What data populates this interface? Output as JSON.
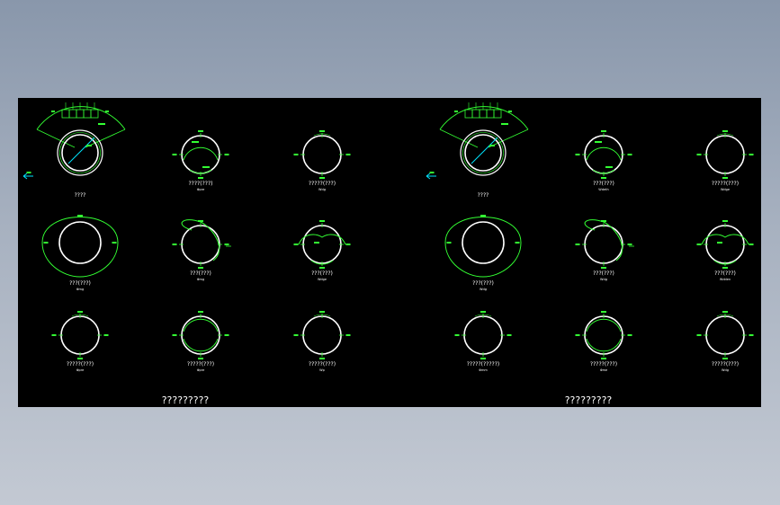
{
  "drawing": {
    "background": "#000000",
    "outer_background": "#95a2b5",
    "line_color": "#33ff33",
    "circle_color": "#ffffff",
    "sheets": [
      {
        "footer": "?????????",
        "details": [
          {
            "title": "????",
            "sub": ""
          },
          {
            "title": "????(???)",
            "sub": "Φpre"
          },
          {
            "title": "?????(???)",
            "sub": "Wdg"
          },
          {
            "title": "???(???)",
            "sub": "Φmg"
          },
          {
            "title": "???(???)",
            "sub": "Φmg"
          },
          {
            "title": "???(???)",
            "sub": "Wdge"
          },
          {
            "title": "?????(???)",
            "sub": "Φpre"
          },
          {
            "title": "?????(???)",
            "sub": "Φpre"
          },
          {
            "title": "?????(???)",
            "sub": "Wp"
          }
        ]
      },
      {
        "footer": "?????????",
        "details": [
          {
            "title": "????",
            "sub": ""
          },
          {
            "title": "???(???)",
            "sub": "Wdeth"
          },
          {
            "title": "?????(???)",
            "sub": "Wdge"
          },
          {
            "title": "???(???)",
            "sub": "Wdg"
          },
          {
            "title": "???(???)",
            "sub": "Wdg"
          },
          {
            "title": "???(???)",
            "sub": "Wdden"
          },
          {
            "title": "?????(?????)",
            "sub": "Φmm"
          },
          {
            "title": "?????(???)",
            "sub": "Φme"
          },
          {
            "title": "?????(???)",
            "sub": "Wdg"
          }
        ]
      }
    ]
  }
}
